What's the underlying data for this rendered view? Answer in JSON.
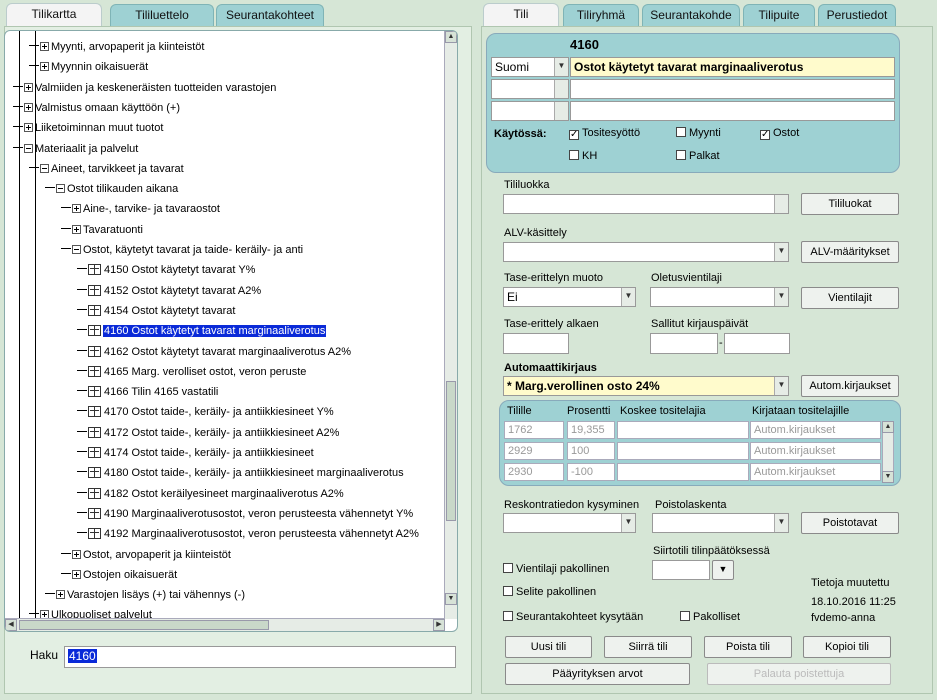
{
  "left_tabs": [
    "Tilikartta",
    "Tililuettelo",
    "Seurantakohteet"
  ],
  "right_tabs": [
    "Tili",
    "Tiliryhmä",
    "Seurantakohde",
    "Tilipuite",
    "Perustiedot"
  ],
  "tree": [
    {
      "label": "Myynti, arvopaperit ja kiinteistöt",
      "type": "plus"
    },
    {
      "label": "Myynnin oikaisuerät",
      "type": "plus"
    },
    {
      "label": "Valmiiden ja keskeneräisten tuotteiden varastojen",
      "type": "plus"
    },
    {
      "label": "Valmistus omaan käyttöön (+)",
      "type": "plus"
    },
    {
      "label": "Liiketoiminnan muut tuotot",
      "type": "plus"
    },
    {
      "label": "Materiaalit ja palvelut",
      "type": "minus"
    },
    {
      "label": "Aineet, tarvikkeet ja tavarat",
      "type": "minus"
    },
    {
      "label": "Ostot tilikauden aikana",
      "type": "minus"
    },
    {
      "label": "Aine-, tarvike- ja tavaraostot",
      "type": "plus"
    },
    {
      "label": "Tavaratuonti",
      "type": "plus"
    },
    {
      "label": "Ostot, käytetyt tavarat ja taide- keräily- ja anti",
      "type": "minus"
    },
    {
      "label": "4150 Ostot käytetyt tavarat Y%",
      "type": "leaf"
    },
    {
      "label": "4152 Ostot käytetyt tavarat A2%",
      "type": "leaf"
    },
    {
      "label": "4154 Ostot käytetyt tavarat",
      "type": "leaf"
    },
    {
      "label": "4160 Ostot käytetyt tavarat marginaaliverotus",
      "type": "leaf",
      "selected": true
    },
    {
      "label": "4162 Ostot käytetyt tavarat marginaaliverotus A2%",
      "type": "leaf"
    },
    {
      "label": "4165 Marg. verolliset ostot, veron peruste",
      "type": "leaf"
    },
    {
      "label": "4166 Tilin 4165 vastatili",
      "type": "leaf"
    },
    {
      "label": "4170 Ostot taide-, keräily- ja antiikkiesineet Y%",
      "type": "leaf"
    },
    {
      "label": "4172 Ostot taide-, keräily- ja antiikkiesineet A2%",
      "type": "leaf"
    },
    {
      "label": "4174 Ostot taide-, keräily- ja antiikkiesineet",
      "type": "leaf"
    },
    {
      "label": "4180 Ostot taide-, keräily- ja antiikkiesineet marginaaliverotus",
      "type": "leaf"
    },
    {
      "label": "4182 Ostot keräilyesineet marginaaliverotus A2%",
      "type": "leaf"
    },
    {
      "label": "4190 Marginaaliverotusostot, veron perusteesta vähennetyt Y%",
      "type": "leaf"
    },
    {
      "label": "4192 Marginaaliverotusostot, veron perusteesta vähennetyt A2%",
      "type": "leaf"
    },
    {
      "label": "Ostot, arvopaperit ja kiinteistöt",
      "type": "plus"
    },
    {
      "label": "Ostojen oikaisuerät",
      "type": "plus"
    },
    {
      "label": "Varastojen lisäys (+) tai vähennys (-)",
      "type": "plus"
    },
    {
      "label": "Ulkopuoliset palvelut",
      "type": "plus"
    }
  ],
  "search": {
    "label": "Haku",
    "value": "4160"
  },
  "account": {
    "number": "4160",
    "language": "Suomi",
    "name": "Ostot käytetyt tavarat marginaaliverotus"
  },
  "kaytossa": {
    "label": "Käytössä:",
    "options": [
      {
        "label": "Tositesyöttö",
        "checked": true
      },
      {
        "label": "Myynti",
        "checked": false
      },
      {
        "label": "Ostot",
        "checked": true
      },
      {
        "label": "KH",
        "checked": false
      },
      {
        "label": "Palkat",
        "checked": false
      }
    ]
  },
  "form": {
    "tililuokka_label": "Tililuokka",
    "tililuokat_btn": "Tililuokat",
    "alv_label": "ALV-käsittely",
    "alv_btn": "ALV-määritykset",
    "tase_muoto_label": "Tase-erittelyn muoto",
    "tase_muoto_value": "Ei",
    "oletus_label": "Oletusvientilaji",
    "vientilajit_btn": "Vientilajit",
    "tase_alkaen_label": "Tase-erittely alkaen",
    "sallitut_label": "Sallitut kirjauspäivät",
    "date_separator": "-",
    "auto_label": "Automaattikirjaus",
    "auto_value": "* Marg.verollinen osto 24%",
    "autom_btn": "Autom.kirjaukset"
  },
  "auto_table": {
    "headers": [
      "Tilille",
      "Prosentti",
      "Koskee tositelajia",
      "Kirjataan tositelajille"
    ],
    "rows": [
      [
        "1762",
        "19,355",
        "",
        "Autom.kirjaukset"
      ],
      [
        "2929",
        "100",
        "",
        "Autom.kirjaukset"
      ],
      [
        "2930",
        "-100",
        "",
        "Autom.kirjaukset"
      ]
    ]
  },
  "lower": {
    "reskontra_label": "Reskontratiedon kysyminen",
    "poisto_label": "Poistolaskenta",
    "poistotavat_btn": "Poistotavat",
    "siirtotili_label": "Siirtotili tilinpäätöksessä",
    "vientilaji_pakollinen": "Vientilaji pakollinen",
    "selite_pakollinen": "Selite pakollinen",
    "seuranta_kysytaan": "Seurantakohteet kysytään",
    "pakolliset": "Pakolliset",
    "muutettu_label": "Tietoja muutettu",
    "muutettu_date": "18.10.2016 11:25",
    "muutettu_user": "fvdemo-anna"
  },
  "buttons": {
    "uusi": "Uusi tili",
    "siirra": "Siirrä tili",
    "poista": "Poista tili",
    "kopioi": "Kopioi tili",
    "paayritys": "Pääyrityksen arvot",
    "palauta": "Palauta poistettuja"
  }
}
